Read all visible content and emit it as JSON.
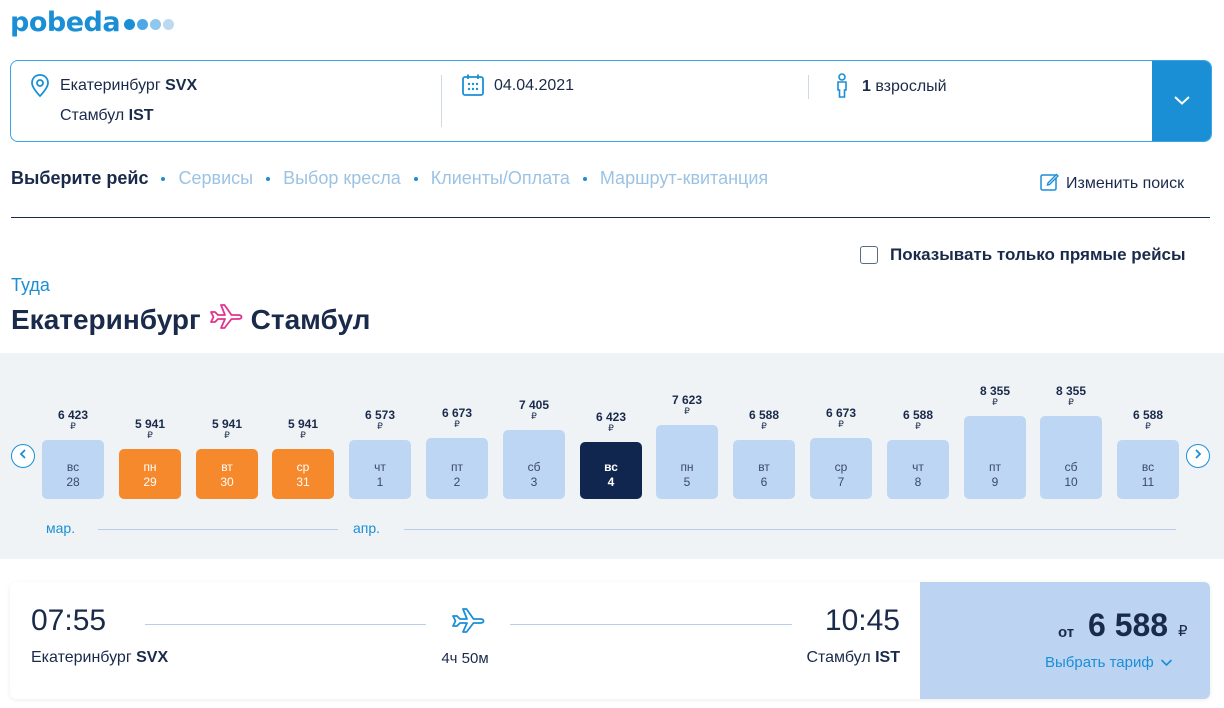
{
  "logo": {
    "text": "pobeda",
    "dot_colors": [
      "#1a8fd6",
      "#4fa8e6",
      "#8fc7ef",
      "#bcd9f2"
    ]
  },
  "search": {
    "from_city": "Екатеринбург",
    "from_code": "SVX",
    "to_city": "Стамбул",
    "to_code": "IST",
    "date": "04.04.2021",
    "pax_count": "1",
    "pax_label": "взрослый"
  },
  "steps": [
    {
      "label": "Выберите рейс",
      "active": true
    },
    {
      "label": "Сервисы",
      "active": false
    },
    {
      "label": "Выбор кресла",
      "active": false
    },
    {
      "label": "Клиенты/Оплата",
      "active": false
    },
    {
      "label": "Маршрут-квитанция",
      "active": false
    }
  ],
  "edit_search_label": "Изменить поиск",
  "direct_only_label": "Показывать только прямые рейсы",
  "direction_label": "Туда",
  "route_title": {
    "from": "Екатеринбург",
    "to": "Стамбул"
  },
  "colors": {
    "accent": "#1a8fd6",
    "dark": "#1a2a4a",
    "orange": "#f5892b",
    "bar": "#bdd6f3",
    "selected": "#11264f"
  },
  "calendar": {
    "currency": "₽",
    "days": [
      {
        "price": "6 423",
        "weekday": "вс",
        "day": "28",
        "level": 0.39,
        "state": "normal"
      },
      {
        "price": "5 941",
        "weekday": "пн",
        "day": "29",
        "level": 0.33,
        "state": "cheapest"
      },
      {
        "price": "5 941",
        "weekday": "вт",
        "day": "30",
        "level": 0.33,
        "state": "cheapest"
      },
      {
        "price": "5 941",
        "weekday": "ср",
        "day": "31",
        "level": 0.33,
        "state": "cheapest"
      },
      {
        "price": "6 573",
        "weekday": "чт",
        "day": "1",
        "level": 0.39,
        "state": "normal"
      },
      {
        "price": "6 673",
        "weekday": "пт",
        "day": "2",
        "level": 0.41,
        "state": "normal"
      },
      {
        "price": "7 405",
        "weekday": "сб",
        "day": "3",
        "level": 0.46,
        "state": "normal"
      },
      {
        "price": "6 423",
        "weekday": "вс",
        "day": "4",
        "level": 0.38,
        "state": "selected"
      },
      {
        "price": "7 623",
        "weekday": "пн",
        "day": "5",
        "level": 0.49,
        "state": "normal"
      },
      {
        "price": "6 588",
        "weekday": "вт",
        "day": "6",
        "level": 0.39,
        "state": "normal"
      },
      {
        "price": "6 673",
        "weekday": "ср",
        "day": "7",
        "level": 0.41,
        "state": "normal"
      },
      {
        "price": "6 588",
        "weekday": "чт",
        "day": "8",
        "level": 0.39,
        "state": "normal"
      },
      {
        "price": "8 355",
        "weekday": "пт",
        "day": "9",
        "level": 0.55,
        "state": "normal"
      },
      {
        "price": "8 355",
        "weekday": "сб",
        "day": "10",
        "level": 0.55,
        "state": "normal"
      },
      {
        "price": "6 588",
        "weekday": "вс",
        "day": "11",
        "level": 0.39,
        "state": "normal"
      }
    ],
    "months": [
      "мар.",
      "апр."
    ]
  },
  "flight": {
    "dep_time": "07:55",
    "dep_city": "Екатеринбург",
    "dep_code": "SVX",
    "arr_time": "10:45",
    "arr_city": "Стамбул",
    "arr_code": "IST",
    "duration": "4ч 50м",
    "price_prefix": "от",
    "price": "6 588",
    "currency": "₽",
    "choose_tariff": "Выбрать тариф"
  }
}
